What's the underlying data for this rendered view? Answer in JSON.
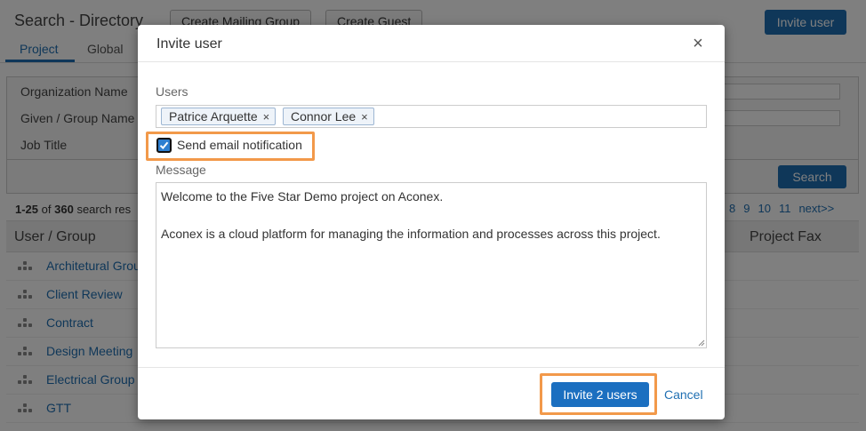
{
  "background": {
    "title": "Search - Directory",
    "buttons": {
      "create_mailing_group": "Create Mailing Group",
      "create_guest": "Create Guest",
      "invite_user": "Invite user"
    },
    "tabs": [
      {
        "label": "Project"
      },
      {
        "label": "Global"
      }
    ],
    "filters": [
      {
        "label": "Organization Name"
      },
      {
        "label": "Given / Group Name"
      },
      {
        "label": "Job Title"
      }
    ],
    "search_label": "Search",
    "results": {
      "range": "1-25",
      "of": "of",
      "total": "360",
      "suffix": "search res"
    },
    "pagination": [
      "8",
      "9",
      "10",
      "11",
      "next>>"
    ],
    "columns": {
      "user_group": "User / Group",
      "project_fax": "Project Fax"
    },
    "rows": [
      {
        "name": "Architetural Grou"
      },
      {
        "name": "Client Review"
      },
      {
        "name": "Contract"
      },
      {
        "name": "Design Meeting"
      },
      {
        "name": "Electrical Group"
      },
      {
        "name": "GTT"
      }
    ]
  },
  "modal": {
    "title": "Invite user",
    "close": "×",
    "users_label": "Users",
    "users": [
      {
        "name": "Patrice Arquette"
      },
      {
        "name": "Connor Lee"
      }
    ],
    "chip_remove": "×",
    "send_email_notification": {
      "label": "Send email notification",
      "checked": true
    },
    "message_label": "Message",
    "message": "Welcome to the Five Star Demo project on Aconex.\n\nAconex is a cloud platform for managing the information and processes across this project.",
    "invite_button": "Invite 2 users",
    "cancel": "Cancel"
  },
  "colors": {
    "primary": "#1b6fc0",
    "highlight": "#f2994a",
    "link": "#1f6fb2"
  }
}
